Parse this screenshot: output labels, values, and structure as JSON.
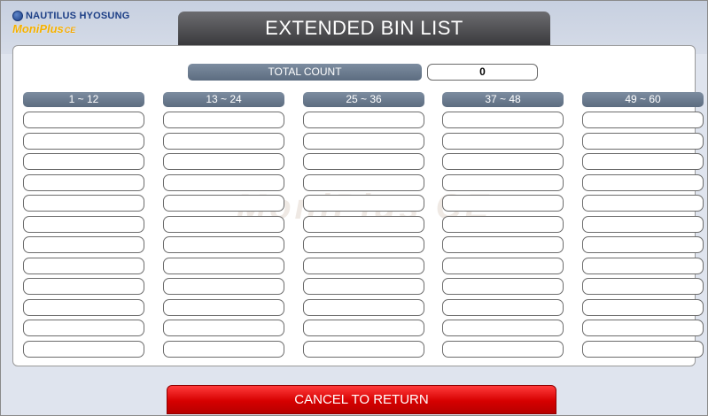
{
  "brand": {
    "company": "NAUTILUS HYOSUNG",
    "product": "MoniPlus",
    "product_tag": "CE",
    "watermark": "MoniPlus CE"
  },
  "header": {
    "title": "EXTENDED BIN LIST"
  },
  "total": {
    "label": "TOTAL COUNT",
    "value": "0"
  },
  "columns": [
    {
      "header": "1 ~ 12",
      "slots": [
        "",
        "",
        "",
        "",
        "",
        "",
        "",
        "",
        "",
        "",
        "",
        ""
      ]
    },
    {
      "header": "13 ~ 24",
      "slots": [
        "",
        "",
        "",
        "",
        "",
        "",
        "",
        "",
        "",
        "",
        "",
        ""
      ]
    },
    {
      "header": "25 ~ 36",
      "slots": [
        "",
        "",
        "",
        "",
        "",
        "",
        "",
        "",
        "",
        "",
        "",
        ""
      ]
    },
    {
      "header": "37 ~ 48",
      "slots": [
        "",
        "",
        "",
        "",
        "",
        "",
        "",
        "",
        "",
        "",
        "",
        ""
      ]
    },
    {
      "header": "49 ~ 60",
      "slots": [
        "",
        "",
        "",
        "",
        "",
        "",
        "",
        "",
        "",
        "",
        "",
        ""
      ]
    }
  ],
  "footer": {
    "cancel_label": "CANCEL TO RETURN"
  },
  "colors": {
    "header_bar": "#5c6c80",
    "title_bar": "#3a3a3d",
    "cancel_button": "#d60000",
    "background": "#dfe4ee"
  }
}
